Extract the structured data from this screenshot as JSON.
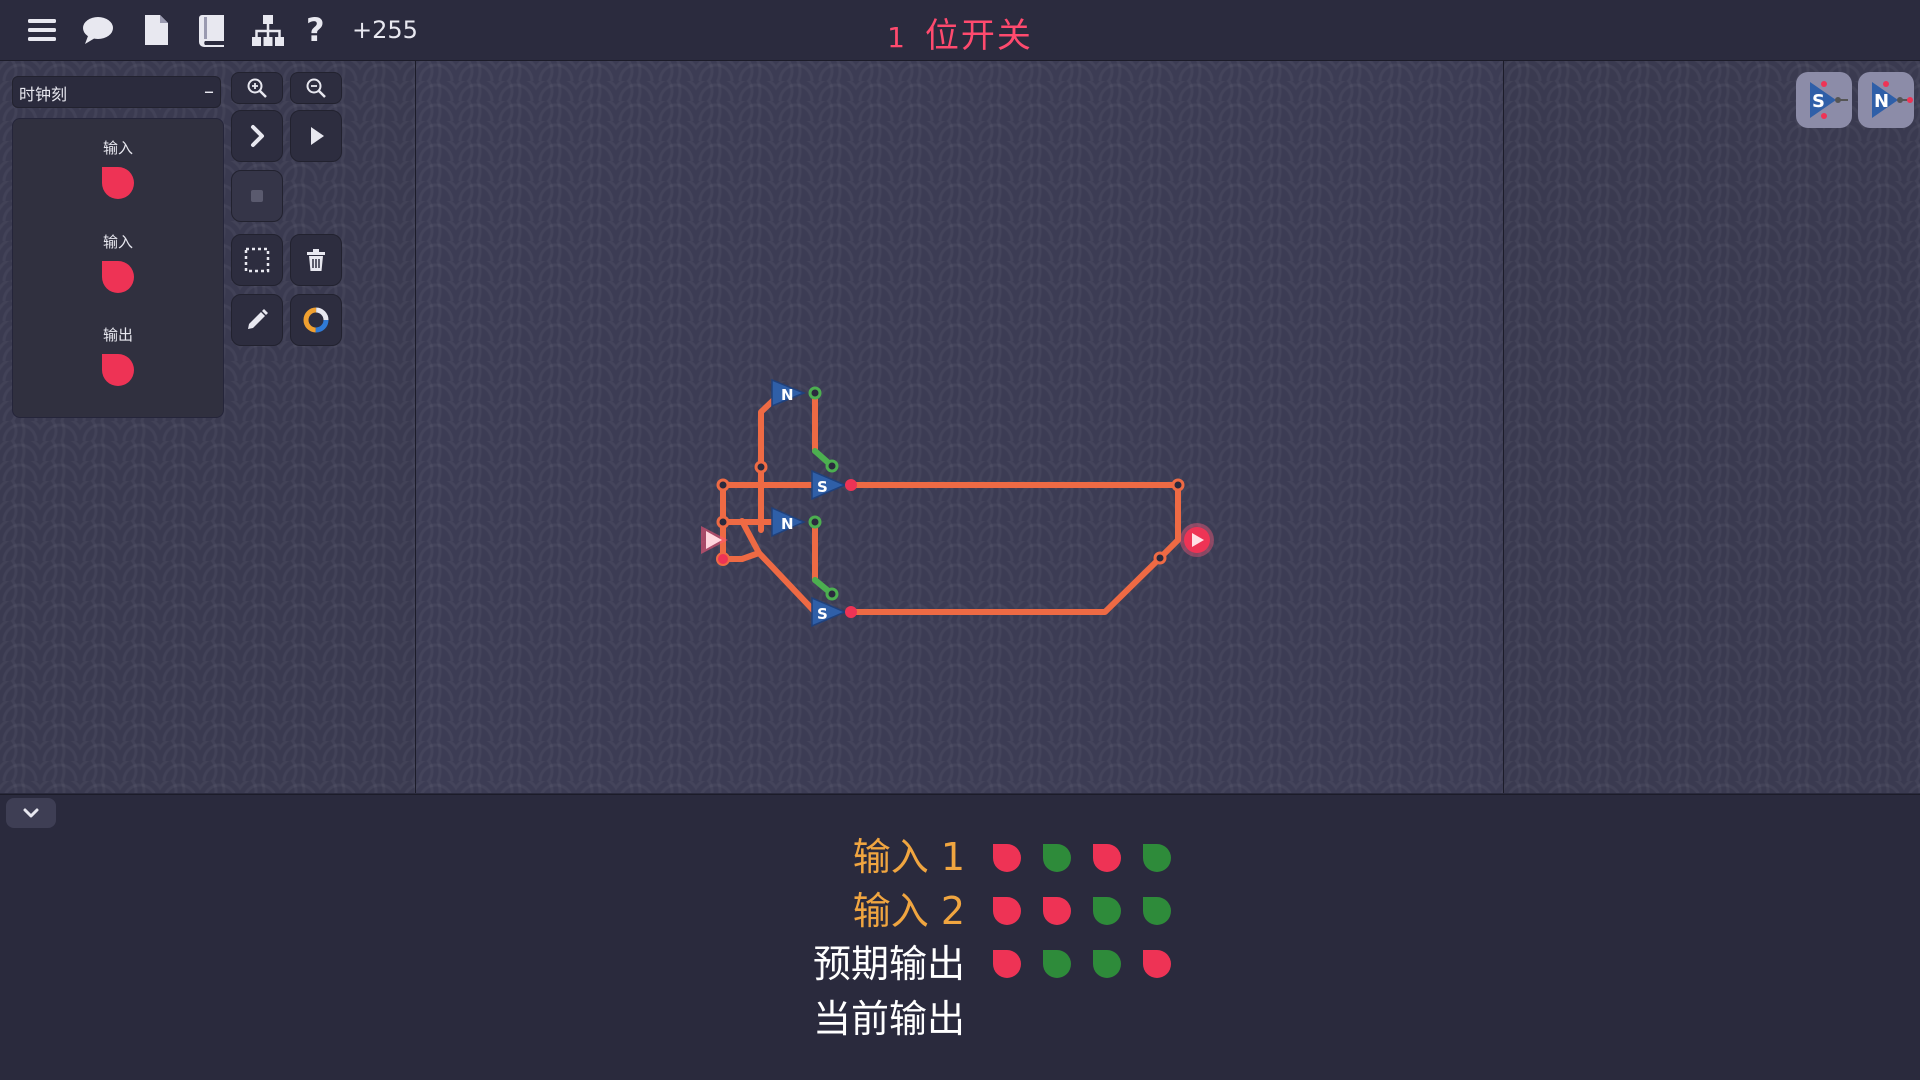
{
  "topbar": {
    "icons": [
      "menu-icon",
      "chat-icon",
      "document-icon",
      "book-icon",
      "hierarchy-icon",
      "help-icon"
    ],
    "help_glyph": "?",
    "score": "+255",
    "level_number": "1",
    "level_title": "位开关"
  },
  "left_panel": {
    "clock_label": "时钟刻",
    "clock_collapse": "–",
    "io_items": [
      {
        "label": "输入",
        "state": "off"
      },
      {
        "label": "输入",
        "state": "off"
      },
      {
        "label": "输出",
        "state": "off"
      }
    ]
  },
  "toolbar": {
    "buttons": [
      "zoom-in",
      "zoom-out",
      "step",
      "play",
      "stop",
      "select-area",
      "delete",
      "pencil",
      "color-wheel"
    ]
  },
  "palette": {
    "components": [
      {
        "type": "S",
        "name": "s-transistor"
      },
      {
        "type": "N",
        "name": "n-transistor"
      }
    ]
  },
  "circuit": {
    "transistors": [
      {
        "type": "N"
      },
      {
        "type": "S"
      },
      {
        "type": "N"
      },
      {
        "type": "S"
      }
    ],
    "wire_color": "#ee6a44",
    "node_color": "#ff4466",
    "output_node_color": "#4caf50"
  },
  "truth_table": {
    "rows": [
      {
        "label": "输入 1",
        "color": "orange",
        "values": [
          "off",
          "on",
          "off",
          "on"
        ]
      },
      {
        "label": "输入 2",
        "color": "orange",
        "values": [
          "off",
          "off",
          "on",
          "on"
        ]
      },
      {
        "label": "预期输出",
        "color": "white",
        "values": [
          "off",
          "on",
          "on",
          "off"
        ]
      },
      {
        "label": "当前输出",
        "color": "white",
        "values": []
      }
    ]
  },
  "colors": {
    "off": "#ee3355",
    "on": "#2e8b3a",
    "title": "#ff4a6e",
    "orange_label": "#f0a540"
  }
}
